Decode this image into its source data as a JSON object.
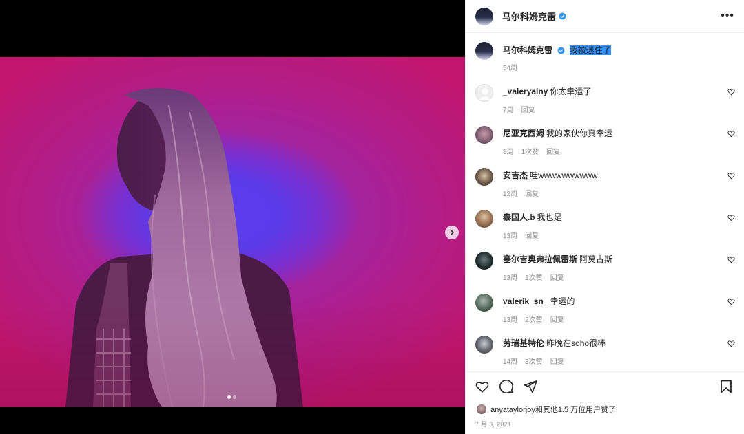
{
  "post": {
    "author": "马尔科姆克雷",
    "caption_text": "我被迷住了",
    "caption_time": "54周",
    "carousel": {
      "current": 1,
      "total": 2
    }
  },
  "comments": [
    {
      "user": "_valeryalny",
      "text": "你太幸运了",
      "time": "7周",
      "likes": "",
      "reply": "回复"
    },
    {
      "user": "尼亚克西姆",
      "text": "我的家伙你真幸运",
      "time": "8周",
      "likes": "1次赞",
      "reply": "回复"
    },
    {
      "user": "安吉杰",
      "text": "哇wwwwwwwwww",
      "time": "12周",
      "likes": "",
      "reply": "回复"
    },
    {
      "user": "泰国人.b",
      "text": "我也是",
      "time": "13周",
      "likes": "",
      "reply": "回复"
    },
    {
      "user": "塞尔吉奥弗拉佩雷斯",
      "text": "阿莫古斯",
      "time": "13周",
      "likes": "1次赞",
      "reply": "回复"
    },
    {
      "user": "valerik_sn_",
      "text": "幸运的",
      "time": "13周",
      "likes": "2次赞",
      "reply": "回复"
    },
    {
      "user": "劳瑞基特伦",
      "text": "昨晚在soho很棒",
      "time": "14周",
      "likes": "3次赞",
      "reply": "回复"
    }
  ],
  "footer": {
    "liked_by": "anyataylorjoy和其他1.5 万位用户赞了",
    "date": "7 月 3, 2021"
  },
  "icons": {
    "more": "more-options-icon",
    "verified": "verified-badge-icon",
    "heart": "heart-icon",
    "comment": "comment-icon",
    "share": "share-icon",
    "bookmark": "bookmark-icon",
    "next": "chevron-right-icon"
  },
  "colors": {
    "verified": "#3897f0",
    "highlight": "#3390ff",
    "muted": "#8e8e8e"
  }
}
